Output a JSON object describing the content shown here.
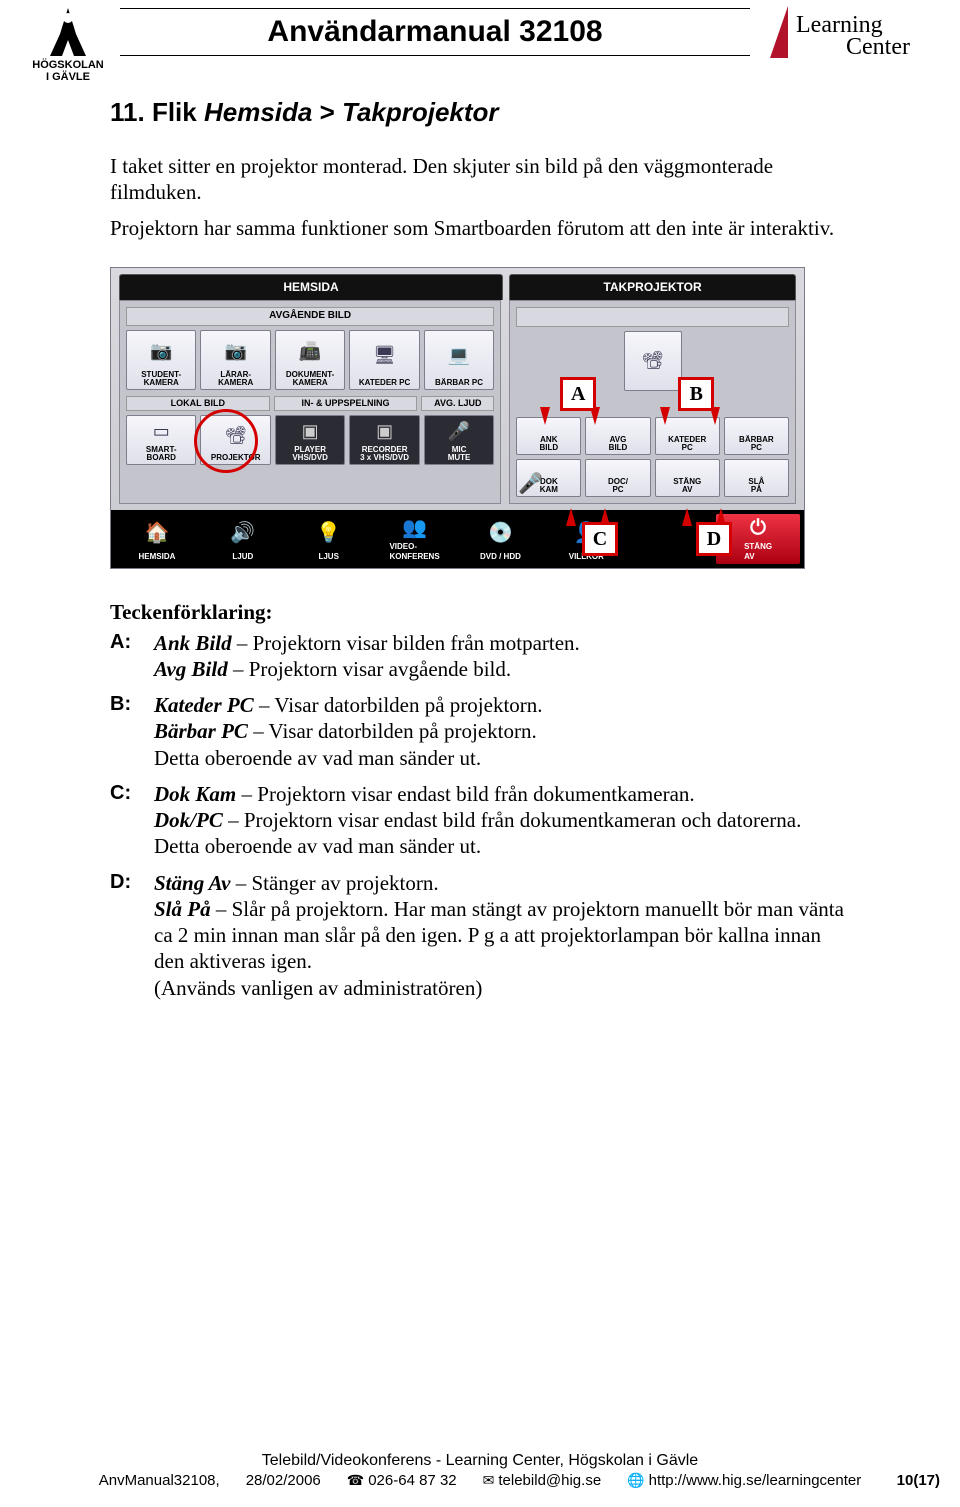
{
  "header": {
    "title": "Användarmanual 32108",
    "left_logo": {
      "line1": "HÖGSKOLAN",
      "line2": "I GÄVLE"
    },
    "right_logo": {
      "line1": "Learning",
      "line2": "Center"
    }
  },
  "section": {
    "number": "11.",
    "word_flik": "Flik",
    "word_hemsida": "Hemsida",
    "word_gt": ">",
    "word_takprojektor": "Takprojektor"
  },
  "intro": {
    "p1": "I taket sitter en projektor monterad. Den skjuter sin bild på den väggmonterade filmduken.",
    "p2": "Projektorn har samma funktioner som Smartboarden förutom att den inte är interaktiv."
  },
  "panel": {
    "tabs": {
      "left": "HEMSIDA",
      "right": "TAKPROJEKTOR"
    },
    "left_pane": {
      "sub1": "AVGÅENDE BILD",
      "row1": [
        {
          "label": "STUDENT-\nKAMERA",
          "icon": "📷"
        },
        {
          "label": "LÄRAR-\nKAMERA",
          "icon": "📷"
        },
        {
          "label": "DOKUMENT-\nKAMERA",
          "icon": "📠"
        },
        {
          "label": "KATEDER PC",
          "icon": "🖥"
        },
        {
          "label": "BÄRBAR PC",
          "icon": "💻"
        }
      ],
      "sub2a": "LOKAL BILD",
      "sub2b": "IN- & UPPSPELNING",
      "sub2c": "AVG. LJUD",
      "row2": [
        {
          "label": "SMART-\nBOARD",
          "icon": "▭"
        },
        {
          "label": "PROJEKTOR",
          "icon": "📽"
        },
        {
          "label": "PLAYER\nVHS/DVD",
          "icon": "▣"
        },
        {
          "label": "RECORDER\n3 x VHS/DVD",
          "icon": "▣"
        },
        {
          "label": "MIC\nMUTE",
          "icon": "🎤"
        }
      ]
    },
    "right_pane": {
      "top_icon": "📽",
      "row1": [
        {
          "label": "ANK\nBILD"
        },
        {
          "label": "AVG\nBILD"
        },
        {
          "label": "KATEDER\nPC"
        },
        {
          "label": "BÄRBAR\nPC"
        }
      ],
      "row2": [
        {
          "label": "DOK\nKAM"
        },
        {
          "label": "DOC/\nPC"
        },
        {
          "label": "STÄNG\nAV"
        },
        {
          "label": "SLÅ\nPÅ"
        }
      ],
      "mic_icon": "🎤"
    },
    "bottom": [
      {
        "label": "HEMSIDA",
        "icon": "🏠"
      },
      {
        "label": "LJUD",
        "icon": "🔊"
      },
      {
        "label": "LJUS",
        "icon": "💡"
      },
      {
        "label": "VIDEO-\nKONFERENS",
        "icon": "👥"
      },
      {
        "label": "DVD / HDD",
        "icon": "💿"
      },
      {
        "label": "VILLKOR",
        "icon": "👤"
      },
      {
        "label": "",
        "icon": ""
      },
      {
        "label": "STÄNG\nAV",
        "icon": "⏻",
        "red": true
      }
    ],
    "letters": {
      "A": "A",
      "B": "B",
      "C": "C",
      "D": "D"
    }
  },
  "legend": {
    "title": "Teckenförklaring:",
    "A": {
      "k": "A:",
      "l1a": "Ank Bild",
      "l1b": " – Projektorn visar bilden från motparten.",
      "l2a": "Avg Bild",
      "l2b": " – Projektorn visar avgående bild."
    },
    "B": {
      "k": "B:",
      "l1a": "Kateder PC",
      "l1b": " – Visar datorbilden på projektorn.",
      "l2a": "Bärbar PC",
      "l2b": " – Visar datorbilden på projektorn.",
      "l3": "Detta oberoende av vad man sänder ut."
    },
    "C": {
      "k": "C:",
      "l1a": "Dok Kam",
      "l1b": " – Projektorn visar endast bild från dokumentkameran.",
      "l2a": "Dok/PC",
      "l2b": " – Projektorn visar endast bild från dokumentkameran och datorerna. Detta oberoende av vad man sänder ut."
    },
    "D": {
      "k": "D:",
      "l1a": "Stäng Av",
      "l1b": " – Stänger av projektorn.",
      "l2a": "Slå På",
      "l2b": " – Slår på projektorn. Har man stängt av projektorn manuellt bör man vänta ca 2 min innan man slår på den igen. P g a att projektorlampan bör kallna innan den aktiveras igen.",
      "l3": " (Används vanligen av administratören)"
    }
  },
  "footer": {
    "line1": "Telebild/Videokonferens - Learning Center, Högskolan i Gävle",
    "doc": "AnvManual32108,",
    "date": "28/02/2006",
    "phone": "026-64 87 32",
    "email": "telebild@hig.se",
    "url": "http://www.hig.se/learningcenter",
    "page": "10(17)"
  }
}
